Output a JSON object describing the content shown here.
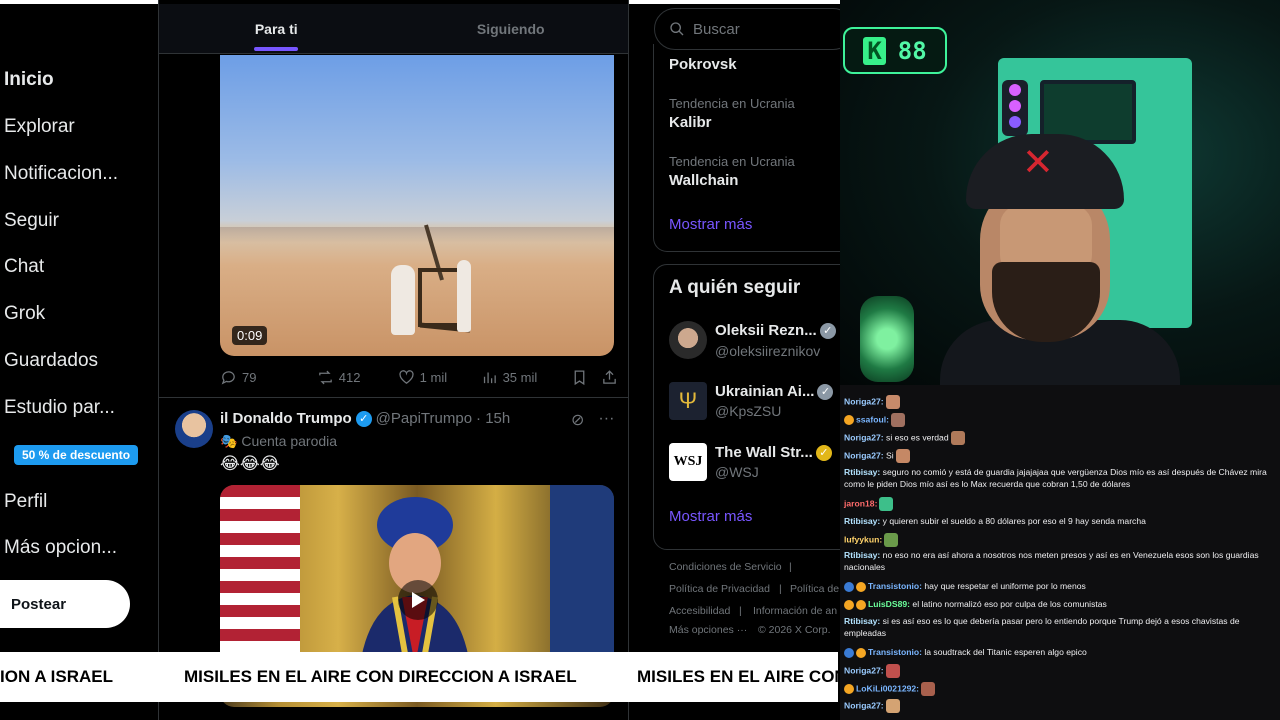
{
  "sidebar": {
    "items": [
      {
        "label": "Inicio"
      },
      {
        "label": "Explorar"
      },
      {
        "label": "Notificacion..."
      },
      {
        "label": "Seguir"
      },
      {
        "label": "Chat"
      },
      {
        "label": "Grok"
      },
      {
        "label": "Guardados"
      },
      {
        "label": "Estudio par..."
      },
      {
        "label": "Perfil"
      },
      {
        "label": "Más opcion..."
      }
    ],
    "promo_badge": "50 % de descuento",
    "post_button": "Postear"
  },
  "timeline": {
    "tabs": [
      "Para ti",
      "Siguiendo"
    ],
    "tweet1": {
      "duration": "0:09",
      "replies": "79",
      "reposts": "412",
      "likes": "1 mil",
      "views": "35 mil"
    },
    "tweet2": {
      "name": "il Donaldo Trumpo",
      "handle": "@PapiTrumpo",
      "time": "· 15h",
      "label": "Cuenta parodia",
      "text": "😂😂😂"
    }
  },
  "ticker": {
    "text": "MISILES EN EL AIRE CON DIRECCION A ISRAEL",
    "left_fragment": "ION A ISRAEL",
    "right_fragment": "MISILES EN EL AIRE CON"
  },
  "rightcol": {
    "search_placeholder": "Buscar",
    "trends": [
      {
        "context": "",
        "name": "Pokrovsk"
      },
      {
        "context": "Tendencia en Ucrania",
        "name": "Kalibr"
      },
      {
        "context": "Tendencia en Ucrania",
        "name": "Wallchain"
      }
    ],
    "show_more": "Mostrar más",
    "follow_title": "A quién seguir",
    "suggestions": [
      {
        "name": "Oleksii Rezn...",
        "handle": "@oleksiireznikov"
      },
      {
        "name": "Ukrainian Ai...",
        "handle": "@KpsZSU"
      },
      {
        "name": "The Wall Str...",
        "handle": "@WSJ"
      }
    ],
    "follow_show_more": "Mostrar más",
    "footer": [
      "Condiciones de Servicio",
      "|",
      "Política de Privacidad",
      "|",
      "Política de",
      "Accesibilidad",
      "|",
      "Información de an",
      "Más opciones ···",
      "© 2026 X Corp."
    ]
  },
  "stream": {
    "badge_k": "K",
    "badge_count": "88"
  },
  "chat": {
    "messages": [
      {
        "user": "Noriga27:",
        "text": ""
      },
      {
        "user": "ssafoul:",
        "text": ""
      },
      {
        "user": "Noriga27:",
        "text": " si eso es verdad"
      },
      {
        "user": "Noriga27:",
        "text": " Si"
      },
      {
        "user": "Rtibisay:",
        "text": " seguro no comió y está de guardia jajajajaa que vergüenza Dios mío es así después de Chávez mira como le piden Dios mío así es lo Max recuerda que cobran 1,50 de dólares"
      },
      {
        "user": "jaron18:",
        "text": ""
      },
      {
        "user": "Rtibisay:",
        "text": " y quieren subir el sueldo a 80 dólares por eso el 9 hay senda marcha"
      },
      {
        "user": "lufyykun:",
        "text": ""
      },
      {
        "user": "Rtibisay:",
        "text": " no eso no era así ahora a nosotros nos meten presos y así es en Venezuela esos son los guardias nacionales"
      },
      {
        "user": "Transistonio:",
        "text": " hay que respetar el uniforme por lo menos"
      },
      {
        "user": "LuisDS89:",
        "text": " el latino normalizó eso por culpa de los comunistas"
      },
      {
        "user": "Rtibisay:",
        "text": " si es así eso es lo que debería pasar pero lo entiendo porque Trump dejó a esos chavistas de empleadas"
      },
      {
        "user": "Transistonio:",
        "text": " la soudtrack del Titanic esperen algo epico"
      },
      {
        "user": "Noriga27:",
        "text": ""
      },
      {
        "user": "LoKiLi0021292:",
        "text": ""
      },
      {
        "user": "Noriga27:",
        "text": ""
      }
    ]
  },
  "colors": {
    "accent": "#7856ff",
    "x_blue": "#1d9bf0",
    "stream_green": "#3ef39a"
  }
}
